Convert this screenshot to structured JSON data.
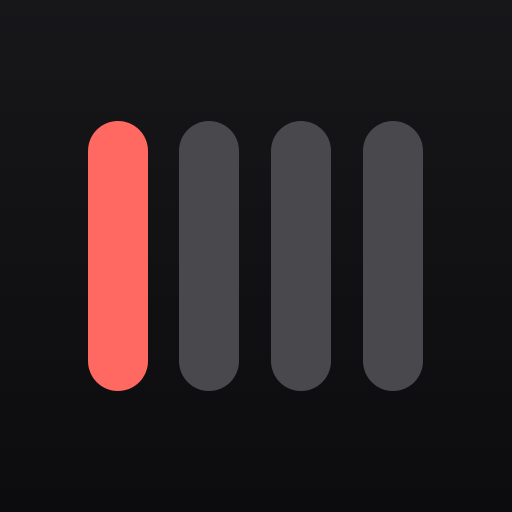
{
  "bars": [
    {
      "state": "active",
      "color": "#ff6961"
    },
    {
      "state": "inactive",
      "color": "#48484d"
    },
    {
      "state": "inactive",
      "color": "#48484d"
    },
    {
      "state": "inactive",
      "color": "#48484d"
    }
  ],
  "colors": {
    "background": "#121214",
    "active": "#ff6961",
    "inactive": "#48484d"
  }
}
